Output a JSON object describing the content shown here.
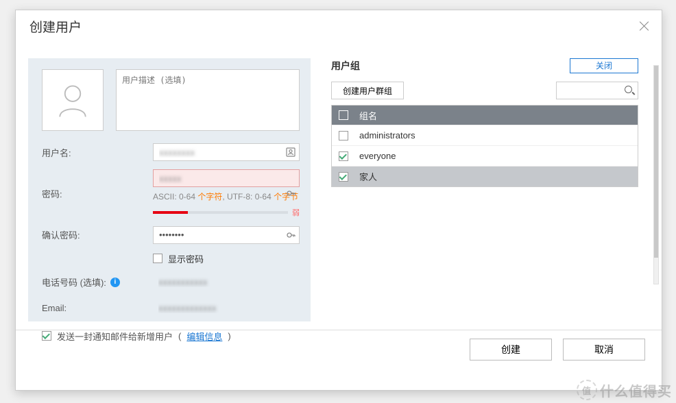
{
  "dialog": {
    "title": "创建用户"
  },
  "left": {
    "desc_placeholder": "用户描述 (选填)",
    "labels": {
      "username": "用户名:",
      "password": "密码:",
      "confirm": "确认密码:",
      "show_pw": "显示密码",
      "phone": "电话号码 (选填):",
      "email": "Email:"
    },
    "values": {
      "username": "xxxxxxxx",
      "password": "xxxxx",
      "confirm": "••••••••",
      "phone": "xxxxxxxxxxx",
      "email": "xxxxxxxxxxxxx"
    },
    "pw_hint_pre": "ASCII: 0-64 ",
    "pw_hint_hl1": "个字符",
    "pw_hint_mid": ", UTF-8: 0-64 ",
    "pw_hint_hl2": "个字节",
    "strength_label": "弱",
    "send_notification": "发送一封通知邮件给新增用户",
    "edit_info": "编辑信息"
  },
  "right": {
    "title": "用户组",
    "close_btn": "关闭",
    "create_group_btn": "创建用户群组",
    "col_name": "组名",
    "rows": [
      {
        "name": "administrators",
        "checked": false,
        "selected": false
      },
      {
        "name": "everyone",
        "checked": true,
        "selected": false
      },
      {
        "name": "家人",
        "checked": true,
        "selected": true
      }
    ]
  },
  "footer": {
    "create": "创建",
    "cancel": "取消"
  },
  "watermark": {
    "badge": "值",
    "text": "什么值得买"
  }
}
